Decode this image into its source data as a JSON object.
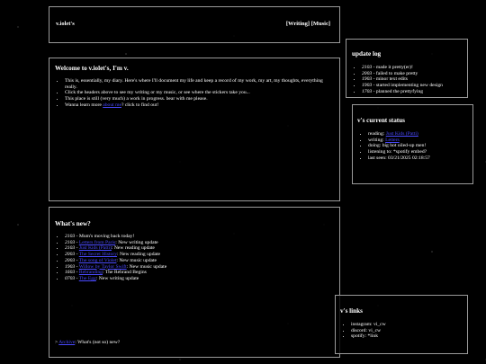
{
  "header": {
    "site_name": "v.iolet's",
    "nav": [
      "[Writing]",
      "[Music]"
    ]
  },
  "welcome": {
    "title": "Welcome to v.iolet's, I'm v.",
    "items": [
      "This is, essentially, my diary. Here's where I'll document my life and keep a record of my work, my art, my thoughts, everything really.",
      "Click the headers above to see my writing or my music, or see where the stickers take you...",
      "This place is still (very much) a work in progress. bear with me please."
    ],
    "learn_more_prefix": "Wanna learn more ",
    "learn_more_link": "about me",
    "learn_more_suffix": "? click to find out!"
  },
  "whats_new": {
    "title": "What's new?",
    "entries": [
      {
        "date": "2103",
        "link": "",
        "text": "Mum's moving back today!"
      },
      {
        "date": "2103",
        "link": "Letters from Paris",
        "text": ": New writing update"
      },
      {
        "date": "2103",
        "link": "Just Kids (Patti)",
        "text": ": New reading update"
      },
      {
        "date": "2003",
        "link": "The Secret History",
        "text": ": New reading update"
      },
      {
        "date": "2003",
        "link": "The song of Violet",
        "text": ": New music update"
      },
      {
        "date": "1903",
        "link": "Willow by Taylor Swift",
        "text": ": New music update"
      },
      {
        "date": "1603",
        "link": "Rebranding",
        "text": ": The Rebrand Begins"
      },
      {
        "date": "0703",
        "link": "The Egg",
        "text": ": New writing update"
      }
    ],
    "footer_prefix": "> ",
    "footer_link": "Archive",
    "footer_suffix": ": What's (not so) new?"
  },
  "update_log": {
    "title": "update log",
    "entries": [
      {
        "date": "2103",
        "text": " - made it pretty(er)!"
      },
      {
        "date": "2003",
        "text": " - failed to make pretty"
      },
      {
        "date": "1903",
        "text": " - minor text edits"
      },
      {
        "date": "1903",
        "text": " - started implementing new design"
      },
      {
        "date": "1703",
        "text": " - planned the prettyfying"
      }
    ]
  },
  "status": {
    "title": "v's current status",
    "reading_label": "reading: ",
    "reading_link": "Just Kids (Patti)",
    "writing_label": "writing: ",
    "writing_link": "Letters",
    "doing": "doing: big hot oiled-up men!",
    "listening": "listening to: *spotify embed?",
    "last_seen": "last seen: 03/21/2025 02:18:57"
  },
  "links": {
    "title": "v's links",
    "items": [
      "instagram: vi_cw",
      "discord: vi_cw",
      "spotify: *link"
    ]
  },
  "colors": {
    "background": "#000000",
    "link": "#4a4aff",
    "border": "#9a9a9a"
  }
}
